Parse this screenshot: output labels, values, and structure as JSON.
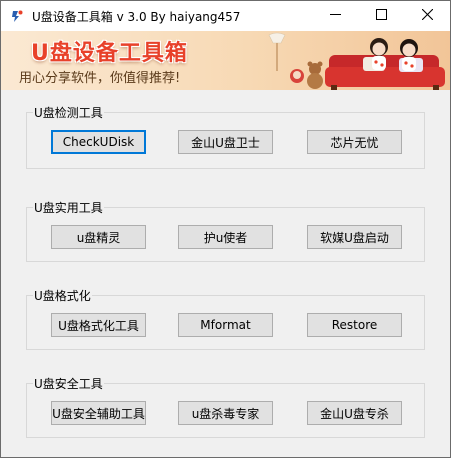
{
  "window": {
    "title": "U盘设备工具箱 v  3.0  By haiyang457"
  },
  "banner": {
    "title": "U盘设备工具箱",
    "slogan": "用心分享软件，你值得推荐!"
  },
  "groups": [
    {
      "title": "U盘检测工具",
      "buttons": [
        "CheckUDisk",
        "金山U盘卫士",
        "芯片无忧"
      ]
    },
    {
      "title": "U盘实用工具",
      "buttons": [
        "u盘精灵",
        "护u使者",
        "软媒U盘启动"
      ]
    },
    {
      "title": "U盘格式化",
      "buttons": [
        "U盘格式化工具",
        "Mformat",
        "Restore"
      ]
    },
    {
      "title": "U盘安全工具",
      "buttons": [
        "U盘安全辅助工具",
        "u盘杀毒专家",
        "金山U盘专杀"
      ]
    }
  ],
  "colors": {
    "banner_title": "#e8412a",
    "focus_border": "#0078d7",
    "window_bg": "#f0f0f0"
  },
  "icons": {
    "app": "app-logo-icon",
    "minimize": "minimize-icon",
    "maximize": "maximize-icon",
    "close": "close-icon"
  }
}
